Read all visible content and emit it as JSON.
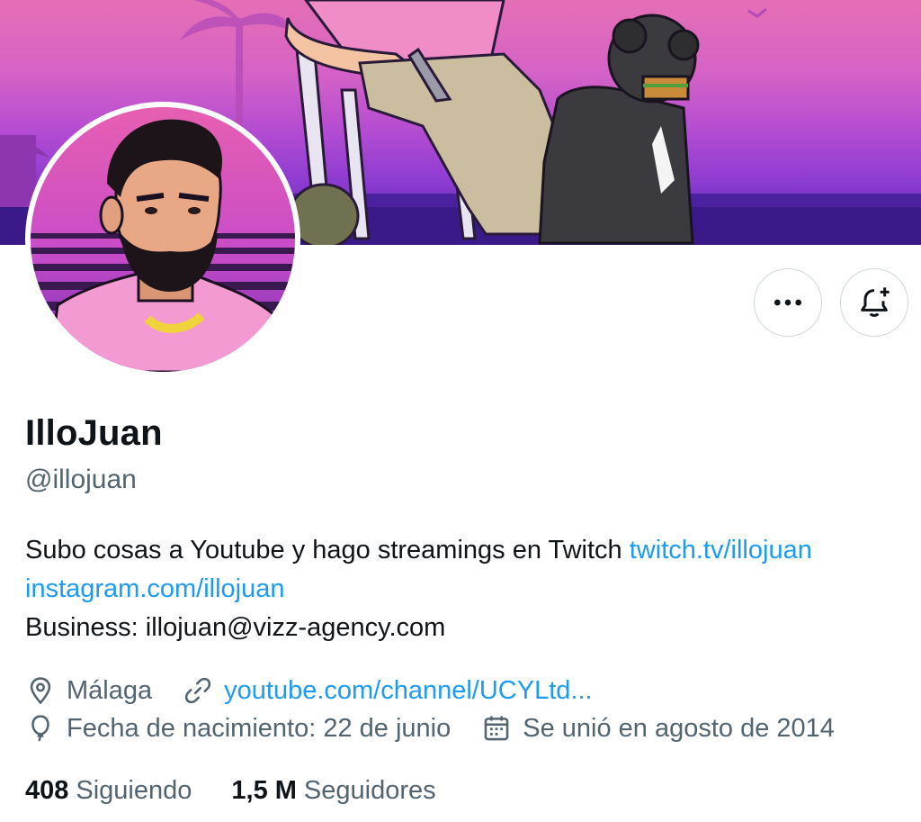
{
  "profile": {
    "display_name": "IlloJuan",
    "handle": "@illojuan",
    "bio_line1_text": "Subo cosas a Youtube y hago streamings en Twitch ",
    "bio_line1_link": "twitch.tv/illojuan",
    "bio_line2_link": "instagram.com/illojuan",
    "bio_line3": "Business: illojuan@vizz-agency.com",
    "location": "Málaga",
    "website": "youtube.com/channel/UCYLtd...",
    "birthday": "Fecha de nacimiento: 22 de junio",
    "joined": "Se unió en agosto de 2014"
  },
  "stats": {
    "following_count": "408",
    "following_label": "Siguiendo",
    "followers_count": "1,5 M",
    "followers_label": "Seguidores"
  },
  "icons": {
    "more": "more-dots-icon",
    "notify": "bell-plus-icon",
    "location": "location-pin-icon",
    "link": "link-icon",
    "birthday": "balloon-icon",
    "calendar": "calendar-icon"
  },
  "colors": {
    "link": "#1d9bf0",
    "secondary_text": "#536471",
    "primary_text": "#0f1419",
    "border": "#cfd9de"
  }
}
